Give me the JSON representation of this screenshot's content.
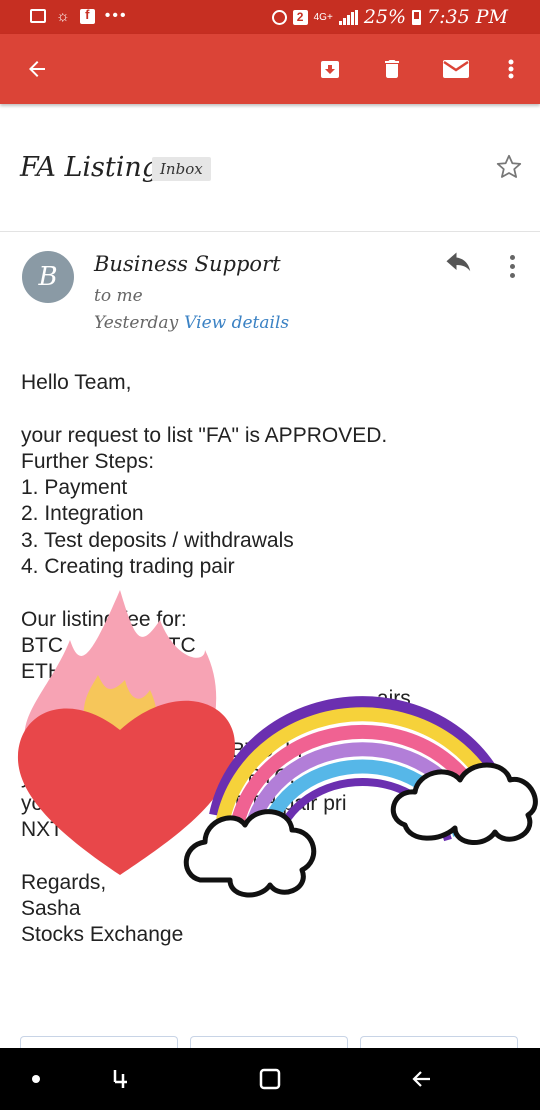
{
  "status_bar": {
    "battery": "25%",
    "time": "7:35 PM",
    "network": "4G+",
    "notification_count": "2"
  },
  "toolbar": {
    "icons": [
      "back-arrow-icon",
      "archive-icon",
      "delete-icon",
      "mark-unread-icon",
      "more-vert-icon"
    ]
  },
  "email": {
    "subject": "FA Listing",
    "label": "Inbox",
    "sender_initial": "B",
    "sender": "Business Support",
    "recipient": "to me",
    "date": "Yesterday",
    "view_details": "View details",
    "body": "Hello Team,\n\nyour request to list \"FA\" is APPROVED.\nFurther Steps:\n1. Payment\n2. Integration\n3. Test deposits / withdrawals\n4. Creating trading pair\n\nOur listing fee for:\nBTC         1       TC\nETH\n                                                             airs\n\n                                 5 BTC. In\nyou                              5 BTC.\nyou tak                         ETH pair pri\nNXT market\n\nRegards,\nSasha\nStocks Exchange"
  },
  "colors": {
    "status_bar": "#c62f22",
    "toolbar": "#db4437",
    "avatar": "#8a9aa5",
    "link": "#3b82c4"
  }
}
